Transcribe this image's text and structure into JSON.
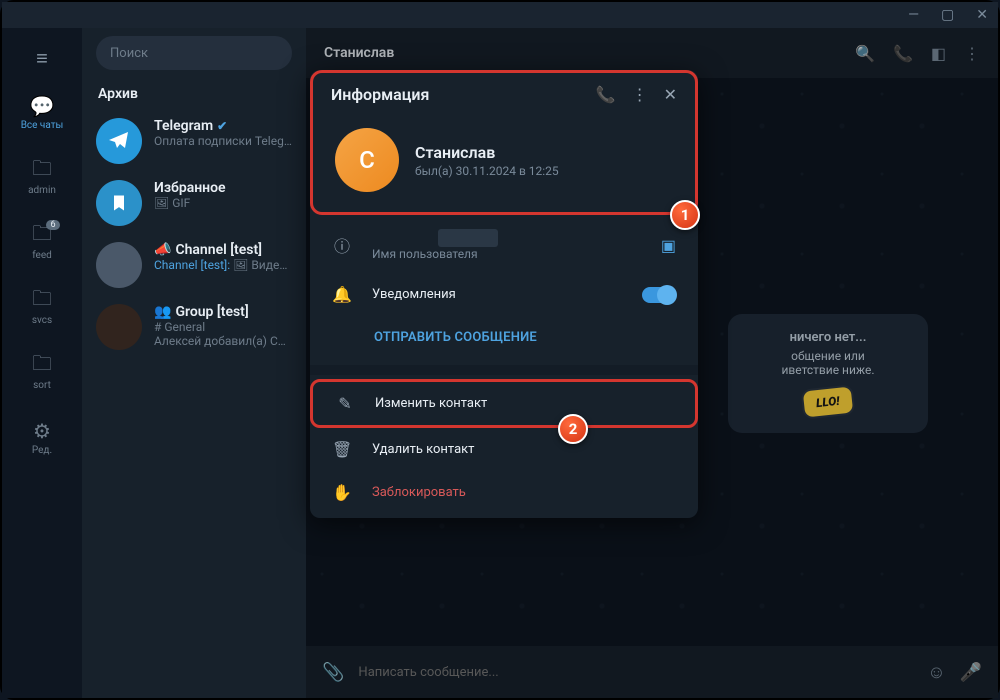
{
  "window": {
    "min": "—",
    "max": "▢",
    "close": "✕"
  },
  "vnav": {
    "all_chats": "Все чаты",
    "admin": "admin",
    "feed": "feed",
    "feed_badge": "6",
    "svcs": "svcs",
    "sort": "sort",
    "edit": "Ред."
  },
  "search": {
    "placeholder": "Поиск"
  },
  "archive_label": "Архив",
  "chats": {
    "tg": {
      "name": "Telegram",
      "sub": "Оплата подписки Telegr…"
    },
    "saved": {
      "name": "Избранное",
      "sub": "GIF"
    },
    "chan": {
      "name": "Channel [test]",
      "sub_prefix": "Channel [test]:",
      "sub_rest": " 🖼 Видео…"
    },
    "grp": {
      "name": "Group [test]",
      "sub": "# General",
      "sub2": "Алексей добавил(а) Сем…"
    }
  },
  "chat_header": {
    "title": "Станислав"
  },
  "empty": {
    "title": "ничего нет...",
    "line": "общение или\nиветствие ниже.",
    "sticker": "LLO!"
  },
  "composer": {
    "placeholder": "Написать сообщение..."
  },
  "modal": {
    "title": "Информация",
    "name": "Станислав",
    "avatar_letter": "С",
    "last_seen": "был(а) 30.11.2024 в 12:25",
    "username_label": "Имя пользователя",
    "notifications": "Уведомления",
    "send_message": "ОТПРАВИТЬ СООБЩЕНИЕ",
    "edit_contact": "Изменить контакт",
    "delete_contact": "Удалить контакт",
    "block": "Заблокировать"
  },
  "markers": {
    "one": "1",
    "two": "2"
  }
}
